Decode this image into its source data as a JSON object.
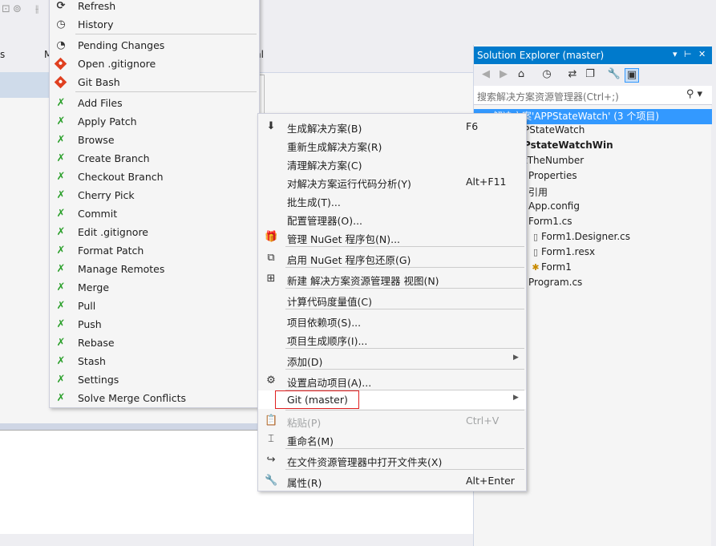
{
  "background": {
    "tabs": [
      "s",
      "M",
      "nl"
    ]
  },
  "solution_explorer": {
    "title": "Solution Explorer (master)",
    "title_controls": [
      "▾",
      "⊢",
      "✕"
    ],
    "search_placeholder": "搜索解决方案资源管理器(Ctrl+;)",
    "tree": [
      {
        "label": "解决方案'APPStateWatch' (3 个项目)",
        "selected": true
      },
      {
        "label": "PStateWatch",
        "selected": false
      },
      {
        "label": "PstateWatchWin",
        "selected": false
      },
      {
        "label": "tTheNumber",
        "selected": false
      },
      {
        "label": "Properties",
        "selected": false
      },
      {
        "label": "引用",
        "selected": false
      },
      {
        "label": "App.config",
        "selected": false
      },
      {
        "label": "Form1.cs",
        "selected": false
      },
      {
        "label": "Form1.Designer.cs",
        "selected": false
      },
      {
        "label": "Form1.resx",
        "selected": false
      },
      {
        "label": "Form1",
        "selected": false
      },
      {
        "label": "Program.cs",
        "selected": false
      }
    ]
  },
  "git_menu": {
    "items": [
      {
        "label": "Refresh",
        "icon": "refresh-icon"
      },
      {
        "label": "History",
        "icon": "history-icon"
      },
      {
        "label": "Pending Changes",
        "icon": "clock-icon"
      },
      {
        "label": "Open .gitignore",
        "icon": "git-diamond-icon"
      },
      {
        "label": "Git Bash",
        "icon": "git-diamond-icon"
      },
      {
        "label": "Add Files",
        "icon": "git-tool-icon"
      },
      {
        "label": "Apply Patch",
        "icon": "git-tool-icon"
      },
      {
        "label": "Browse",
        "icon": "git-tool-icon"
      },
      {
        "label": "Create Branch",
        "icon": "git-tool-icon"
      },
      {
        "label": "Checkout Branch",
        "icon": "git-tool-icon"
      },
      {
        "label": "Cherry Pick",
        "icon": "git-tool-icon"
      },
      {
        "label": "Commit",
        "icon": "git-tool-icon"
      },
      {
        "label": "Edit .gitignore",
        "icon": "git-tool-icon"
      },
      {
        "label": "Format Patch",
        "icon": "git-tool-icon"
      },
      {
        "label": "Manage Remotes",
        "icon": "git-tool-icon"
      },
      {
        "label": "Merge",
        "icon": "git-tool-icon"
      },
      {
        "label": "Pull",
        "icon": "git-tool-icon"
      },
      {
        "label": "Push",
        "icon": "git-tool-icon"
      },
      {
        "label": "Rebase",
        "icon": "git-tool-icon"
      },
      {
        "label": "Stash",
        "icon": "git-tool-icon"
      },
      {
        "label": "Settings",
        "icon": "git-tool-icon"
      },
      {
        "label": "Solve Merge Conflicts",
        "icon": "git-tool-icon"
      }
    ]
  },
  "context_menu": {
    "items": [
      {
        "label": "生成解决方案(B)",
        "shortcut": "F6",
        "icon": "build-icon"
      },
      {
        "label": "重新生成解决方案(R)",
        "shortcut": "",
        "icon": ""
      },
      {
        "label": "清理解决方案(C)",
        "shortcut": "",
        "icon": ""
      },
      {
        "label": "对解决方案运行代码分析(Y)",
        "shortcut": "Alt+F11",
        "icon": ""
      },
      {
        "label": "批生成(T)...",
        "shortcut": "",
        "icon": ""
      },
      {
        "label": "配置管理器(O)...",
        "shortcut": "",
        "icon": ""
      },
      {
        "label": "管理 NuGet 程序包(N)...",
        "shortcut": "",
        "icon": "nuget-icon"
      },
      {
        "label": "启用 NuGet 程序包还原(G)",
        "shortcut": "",
        "icon": "restore-icon"
      },
      {
        "label": "新建 解决方案资源管理器 视图(N)",
        "shortcut": "",
        "icon": "new-view-icon"
      },
      {
        "label": "计算代码度量值(C)",
        "shortcut": "",
        "icon": ""
      },
      {
        "label": "项目依赖项(S)...",
        "shortcut": "",
        "icon": ""
      },
      {
        "label": "项目生成顺序(I)...",
        "shortcut": "",
        "icon": ""
      },
      {
        "label": "添加(D)",
        "shortcut": "",
        "icon": "",
        "submenu": true
      },
      {
        "label": "设置启动项目(A)...",
        "shortcut": "",
        "icon": "gear-icon"
      },
      {
        "label": "Git (master)",
        "shortcut": "",
        "icon": "",
        "submenu": true,
        "highlighted": true
      },
      {
        "label": "粘贴(P)",
        "shortcut": "Ctrl+V",
        "icon": "paste-icon",
        "disabled": true
      },
      {
        "label": "重命名(M)",
        "shortcut": "",
        "icon": "rename-icon"
      },
      {
        "label": "在文件资源管理器中打开文件夹(X)",
        "shortcut": "",
        "icon": "open-folder-icon"
      },
      {
        "label": "属性(R)",
        "shortcut": "Alt+Enter",
        "icon": "wrench-icon"
      }
    ]
  }
}
